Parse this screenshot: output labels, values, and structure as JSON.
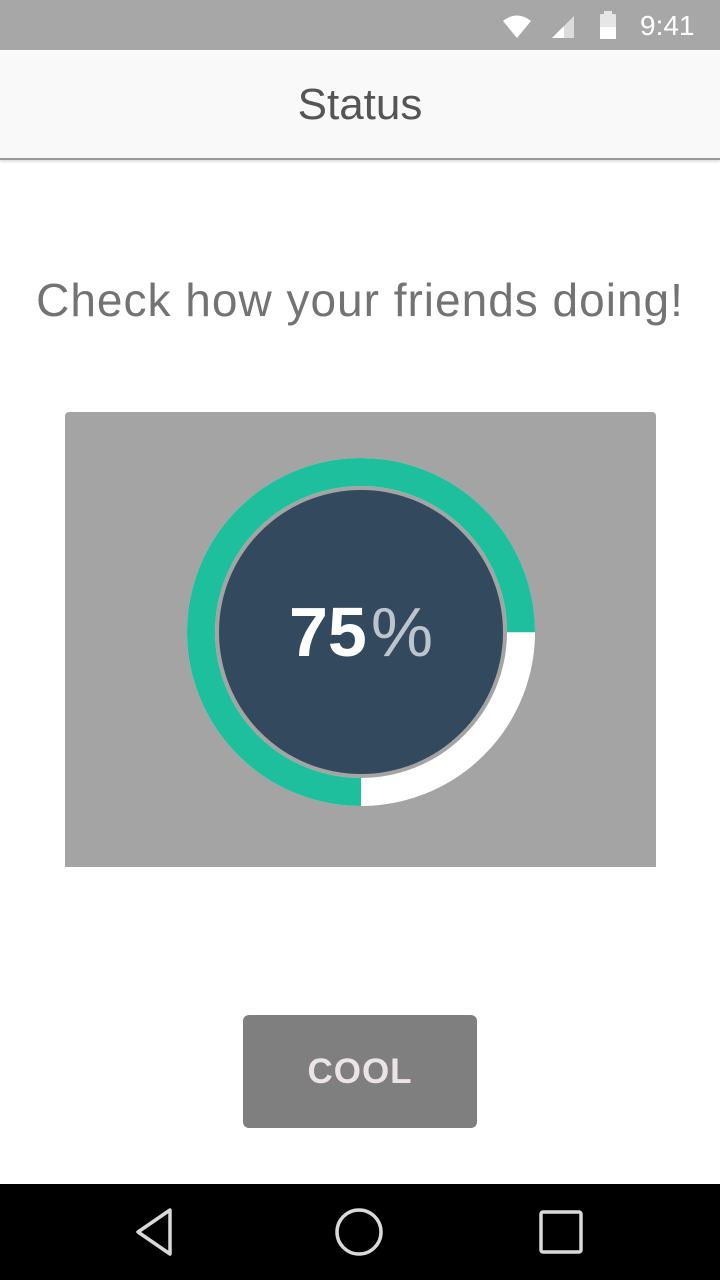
{
  "status_bar": {
    "time": "9:41",
    "icons": [
      "wifi-icon",
      "signal-icon",
      "battery-icon"
    ],
    "background": "#a7a7a7"
  },
  "app_bar": {
    "title": "Status"
  },
  "headline": "Check how your friends doing!",
  "progress": {
    "value": 75,
    "number_label": "75",
    "unit_label": "%",
    "fill_color": "#1dbf9c",
    "track_color": "#ffffff",
    "center_color": "#32495e"
  },
  "action": {
    "label": "COOL"
  },
  "nav_bar": {
    "icons": [
      "back-icon",
      "home-icon",
      "recents-icon"
    ]
  }
}
